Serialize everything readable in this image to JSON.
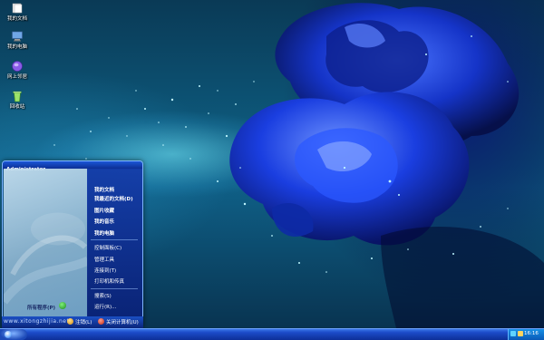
{
  "desktop": {
    "icons": [
      {
        "label": "我的文档",
        "icon": "documents-folder-icon"
      },
      {
        "label": "我的电脑",
        "icon": "computer-icon"
      },
      {
        "label": "网上邻居",
        "icon": "network-icon"
      },
      {
        "label": "回收站",
        "icon": "recycle-bin-icon"
      }
    ]
  },
  "start_menu": {
    "user_name": "Administrator",
    "all_programs_label": "所有程序(P)",
    "right_items": [
      "我的文档",
      "我最近的文档(D)",
      "图片收藏",
      "我的音乐",
      "我的电脑",
      "控制面板(C)",
      "管理工具",
      "连接到(T)",
      "打印机和传真",
      "搜索(S)",
      "运行(R)..."
    ],
    "watermark": "www.xitongzhijia.net",
    "logoff_label": "注销(L)",
    "shutdown_label": "关闭计算机(U)"
  },
  "taskbar": {
    "clock": "16:16"
  },
  "colors": {
    "taskbar_blue": "#1c4bc9",
    "menu_right_blue": "#143ca8",
    "tray_blue": "#1790e6"
  }
}
